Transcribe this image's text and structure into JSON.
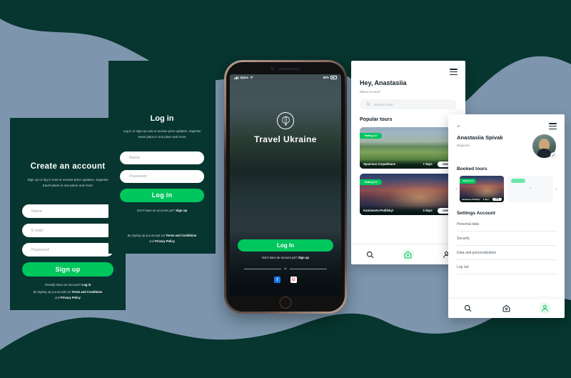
{
  "background": {
    "dark_teal": "#07352f",
    "blue_grey": "#7d96ad",
    "accent_green": "#00c65e"
  },
  "signup_screen": {
    "title": "Create an account",
    "subtitle": "Sign up or log in now to receive price updates, organise travel plans in one place and more",
    "fields": [
      {
        "name": "name",
        "placeholder": "Name",
        "value": ""
      },
      {
        "name": "email",
        "placeholder": "E-mail",
        "value": ""
      },
      {
        "name": "password",
        "placeholder": "Password",
        "value": ""
      }
    ],
    "submit_label": "Sign up",
    "alt_prompt": "Already have an account?",
    "alt_link": "Log in",
    "legal_prefix": "By signing up you accept our",
    "legal_terms": "Terms and Conditions",
    "legal_and": "and",
    "legal_privacy": "Privacy Policy"
  },
  "login_screen": {
    "title": "Log in",
    "subtitle": "Log in or sign up now to receive price updates, organise travel plans in one place and more",
    "fields": [
      {
        "name": "name",
        "placeholder": "Name",
        "value": ""
      },
      {
        "name": "password",
        "placeholder": "Password",
        "value": ""
      }
    ],
    "submit_label": "Log in",
    "alt_prompt": "Don't have an account yet?",
    "alt_link": "Sign up",
    "legal_prefix": "By signing up you accept our",
    "legal_terms": "Terms and Conditions",
    "legal_and": "and",
    "legal_privacy": "Privacy Policy"
  },
  "phone_screen": {
    "status_bar": {
      "carrier": "Optus",
      "battery_percent": "80%",
      "signal_icon": "signal-bars-icon",
      "wifi_icon": "wifi-icon",
      "battery_icon": "battery-icon"
    },
    "brand_logo_icon": "hot-air-balloon-icon",
    "brand_name": "Travel Ukraine",
    "login_label": "Log In",
    "alt_prompt": "Don't have an account yet?",
    "alt_link": "Sign up",
    "divider_label": "or",
    "social": [
      {
        "name": "facebook-login",
        "icon": "facebook-icon",
        "glyph": "f"
      },
      {
        "name": "google-login",
        "icon": "google-icon",
        "glyph": "G"
      }
    ]
  },
  "home_screen": {
    "menu_icon": "hamburger-menu-icon",
    "greeting": "Hey, Anastasiia",
    "subtitle": "Where to next?",
    "search_placeholder": "Search a tour",
    "search_icon": "search-icon",
    "section_title": "Popular tours",
    "tours": [
      {
        "name": "Spacious Carpathians",
        "rating_label": "Rating 9.7",
        "duration": "7 days",
        "price": "399$",
        "image": "carpathians-landscape"
      },
      {
        "name": "Kamianets-Podilskyi",
        "rating_label": "Rating 9.2",
        "duration": "3 days",
        "price": "199$",
        "image": "kamianets-castle-night"
      }
    ],
    "nav": [
      {
        "name": "search",
        "icon": "search-icon",
        "active": false
      },
      {
        "name": "home",
        "icon": "home-icon",
        "active": true
      },
      {
        "name": "profile",
        "icon": "person-icon",
        "active": false
      }
    ]
  },
  "profile_screen": {
    "back_icon": "arrow-left-icon",
    "menu_icon": "hamburger-menu-icon",
    "user_name": "Anastasiia Spivak",
    "user_level": "Beginner",
    "avatar_icon": "user-avatar",
    "edit_icon": "edit-pencil-icon",
    "booked_title": "Booked tours",
    "carousel_prev_icon": "chevron-left-icon",
    "carousel_next_icon": "chevron-right-icon",
    "booked_tours": [
      {
        "name": "Kamianets-Podilskyi",
        "rating_label": "Rating 9.2",
        "duration": "3 days",
        "price": "199$",
        "image": "kamianets-castle-night"
      }
    ],
    "add_tour_icon": "plus-icon",
    "settings_title": "Settings Account",
    "settings_items": [
      "Personal data",
      "Security",
      "Data and personalization",
      "Log out"
    ],
    "nav": [
      {
        "name": "search",
        "icon": "search-icon",
        "active": false
      },
      {
        "name": "home",
        "icon": "home-icon",
        "active": false
      },
      {
        "name": "profile",
        "icon": "person-icon",
        "active": true
      }
    ]
  }
}
